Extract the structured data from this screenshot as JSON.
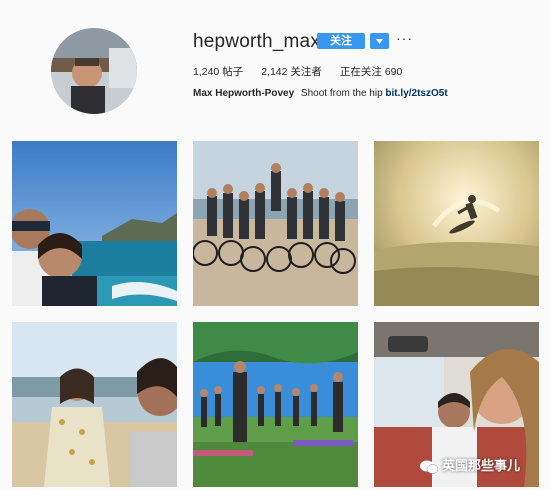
{
  "profile": {
    "username": "hepworth_max",
    "follow_label": "关注",
    "more_label": "···",
    "stats": {
      "posts": "1,240 帖子",
      "followers": "2,142 关注者",
      "following": "正在关注 690"
    },
    "bio": {
      "name": "Max Hepworth-Povey",
      "text": "Shoot from the hip",
      "link": "bit.ly/2tszO5t"
    }
  },
  "watermark": {
    "text": "英国那些事儿"
  },
  "posts": [
    {
      "name": "post-couple-selfie-coast"
    },
    {
      "name": "post-group-cyclists-beach"
    },
    {
      "name": "post-surfer-sunset"
    },
    {
      "name": "post-beach-selfie-woman"
    },
    {
      "name": "post-group-yoga-park"
    },
    {
      "name": "post-car-selfie"
    }
  ],
  "colors": {
    "follow_blue": "#3897f0",
    "link_blue": "#003569"
  }
}
